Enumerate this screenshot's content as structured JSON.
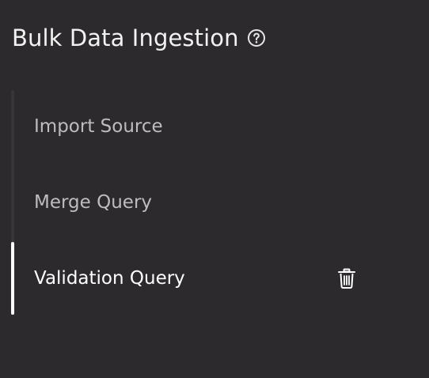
{
  "header": {
    "title": "Bulk Data Ingestion",
    "help_icon": "question-circle-icon"
  },
  "steps": [
    {
      "label": "Import Source",
      "active": false
    },
    {
      "label": "Merge Query",
      "active": false
    },
    {
      "label": "Validation Query",
      "active": true,
      "action_icon": "trash-icon"
    }
  ],
  "colors": {
    "background": "#2c2a2d",
    "active_text": "#ffffff",
    "inactive_text": "#bdbcbe",
    "rail": "#38363a",
    "active_indicator": "#ffffff"
  }
}
